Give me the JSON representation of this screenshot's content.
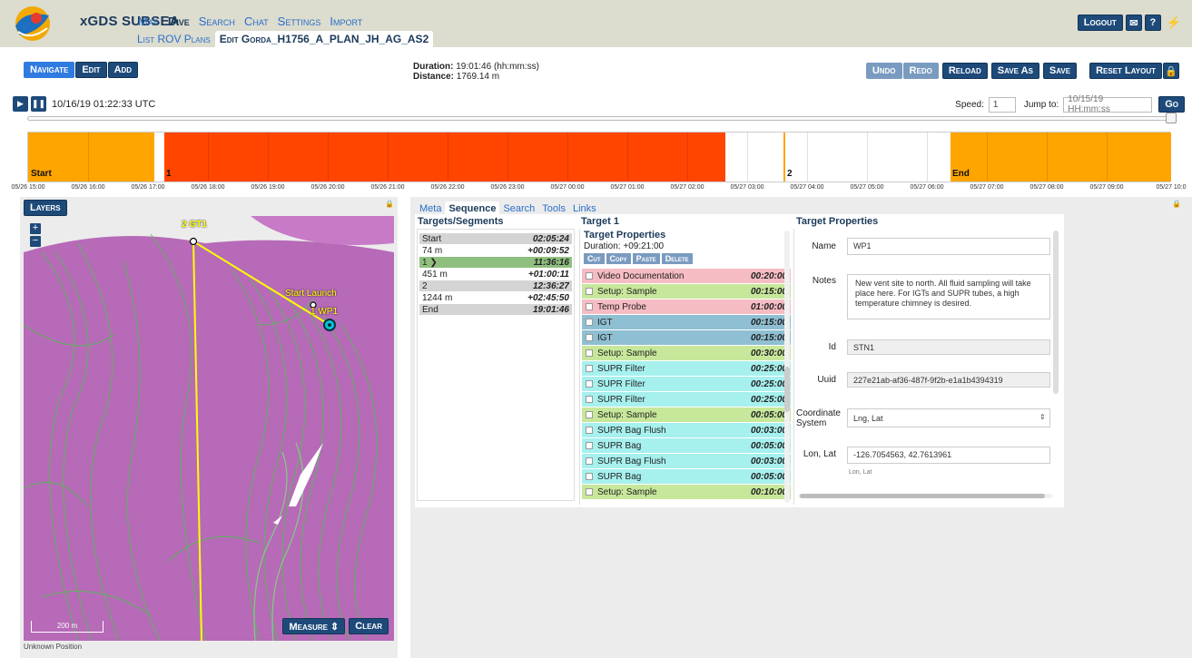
{
  "app": {
    "brand": "xGDS SUBSEA"
  },
  "nav": {
    "items": [
      "Map",
      "Dive",
      "Search",
      "Chat",
      "Settings",
      "Import"
    ],
    "active": "Dive"
  },
  "subnav": {
    "items": [
      "List ROV Plans",
      "Edit Gorda_H1756_A_PLAN_JH_AG_AS2"
    ]
  },
  "header_right": {
    "logout": "Logout",
    "mail_icon": "envelope-icon",
    "help_icon": "question-icon",
    "plug_icon": "plug-icon"
  },
  "modes": {
    "navigate": "Navigate",
    "edit": "Edit",
    "add": "Add"
  },
  "summary": {
    "duration_label": "Duration:",
    "duration": "19:01:46 (hh:mm:ss)",
    "distance_label": "Distance:",
    "distance": "1769.14 m"
  },
  "toolbar": {
    "undo": "Undo",
    "redo": "Redo",
    "reload": "Reload",
    "save_as": "Save As",
    "save": "Save",
    "reset_layout": "Reset Layout"
  },
  "playback": {
    "clock": "10/16/19 01:22:33 UTC",
    "speed_label": "Speed:",
    "speed": "1",
    "jump_label": "Jump to:",
    "jump_placeholder": "10/15/19 HH:mm:ss",
    "go": "Go"
  },
  "timeline": {
    "segment_labels": [
      "Start",
      "1",
      "2",
      "End"
    ],
    "colors": {
      "start": "#ffa500",
      "travel": "#ff4500",
      "gap": "#ffffff",
      "end": "#ffa500"
    },
    "ticks": [
      "05/26 15:00",
      "05/26 16:00",
      "05/26 17:00",
      "05/26 18:00",
      "05/26 19:00",
      "05/26 20:00",
      "05/26 21:00",
      "05/26 22:00",
      "05/26 23:00",
      "05/27 00:00",
      "05/27 01:00",
      "05/27 02:00",
      "05/27 03:00",
      "05/27 04:00",
      "05/27 05:00",
      "05/27 06:00",
      "05/27 07:00",
      "05/27 08:00",
      "05/27 09:00",
      "05/27 10:0"
    ]
  },
  "map": {
    "layers": "Layers",
    "zoom_in": "+",
    "zoom_out": "−",
    "labels": [
      "2 GT1",
      "Start Launch",
      "1 WP1"
    ],
    "scale": "200 m",
    "measure": "Measure ⇕",
    "clear": "Clear",
    "status": "Unknown Position"
  },
  "tabs": [
    "Meta",
    "Sequence",
    "Search",
    "Tools",
    "Links"
  ],
  "targets": {
    "heading": "Targets/Segments",
    "rows": [
      {
        "name": "Start",
        "time": "02:05:24",
        "bg": "#d4d4d4"
      },
      {
        "name": "74 m",
        "time": "+00:09:52",
        "bg": "#ffffff"
      },
      {
        "name": "1 ❯",
        "time": "11:36:16",
        "bg": "#8fbf7f"
      },
      {
        "name": "451 m",
        "time": "+01:00:11",
        "bg": "#ffffff"
      },
      {
        "name": "2",
        "time": "12:36:27",
        "bg": "#d4d4d4"
      },
      {
        "name": "1244 m",
        "time": "+02:45:50",
        "bg": "#ffffff"
      },
      {
        "name": "End",
        "time": "19:01:46",
        "bg": "#d4d4d4"
      }
    ]
  },
  "target1": {
    "heading": "Target 1",
    "props_title": "Target Properties",
    "duration": "Duration: +09:21:00",
    "buttons": [
      "Cut",
      "Copy",
      "Paste",
      "Delete"
    ],
    "steps": [
      {
        "name": "Video Documentation",
        "time": "00:20:00",
        "bg": "#f6bcc3"
      },
      {
        "name": "Setup: Sample",
        "time": "00:15:00",
        "bg": "#c7e79b"
      },
      {
        "name": "Temp Probe",
        "time": "01:00:00",
        "bg": "#f6bcc3"
      },
      {
        "name": "IGT",
        "time": "00:15:00",
        "bg": "#8fbfd2"
      },
      {
        "name": "IGT",
        "time": "00:15:00",
        "bg": "#8fbfd2"
      },
      {
        "name": "Setup: Sample",
        "time": "00:30:00",
        "bg": "#c7e79b"
      },
      {
        "name": "SUPR Filter",
        "time": "00:25:00",
        "bg": "#a6f0ee"
      },
      {
        "name": "SUPR Filter",
        "time": "00:25:00",
        "bg": "#a6f0ee"
      },
      {
        "name": "SUPR Filter",
        "time": "00:25:00",
        "bg": "#a6f0ee"
      },
      {
        "name": "Setup: Sample",
        "time": "00:05:00",
        "bg": "#c7e79b"
      },
      {
        "name": "SUPR Bag Flush",
        "time": "00:03:00",
        "bg": "#a6f0ee"
      },
      {
        "name": "SUPR Bag",
        "time": "00:05:00",
        "bg": "#a6f0ee"
      },
      {
        "name": "SUPR Bag Flush",
        "time": "00:03:00",
        "bg": "#a6f0ee"
      },
      {
        "name": "SUPR Bag",
        "time": "00:05:00",
        "bg": "#a6f0ee"
      },
      {
        "name": "Setup: Sample",
        "time": "00:10:00",
        "bg": "#c7e79b"
      }
    ]
  },
  "properties": {
    "heading": "Target Properties",
    "name_label": "Name",
    "name": "WP1",
    "notes_label": "Notes",
    "notes": "New vent site to north. All fluid sampling will take place here. For IGTs and SUPR tubes, a high temperature chimney is desired.",
    "id_label": "Id",
    "id": "STN1",
    "uuid_label": "Uuid",
    "uuid": "227e21ab-af36-487f-9f2b-e1a1b4394319",
    "coord_label": "Coordinate System",
    "coord": "Lng, Lat",
    "lonlat_label": "Lon, Lat",
    "lonlat": "-126.7054563, 42.7613961",
    "lonlat_hint": "Lon, Lat"
  }
}
